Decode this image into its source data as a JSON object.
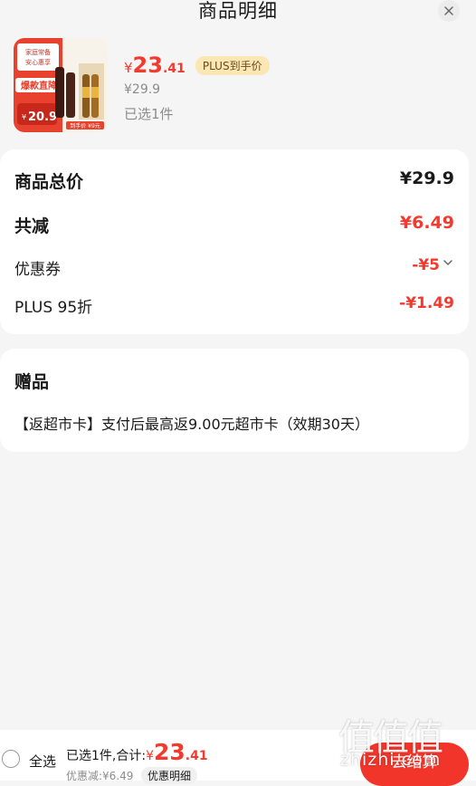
{
  "header": {
    "title": "商品明细"
  },
  "product": {
    "price_symbol": "¥",
    "price_int": "23",
    "price_dec": ".41",
    "plus_tag": "PLUS到手价",
    "original_price": "¥29.9",
    "selected_count": "已选1件",
    "thumb": {
      "badge_top": "家庭常备",
      "badge_bottom": "安心惠享",
      "banner": "爆款直降",
      "price_prefix": "¥",
      "price": "20.9",
      "coupon": "到手价 ¥9元"
    }
  },
  "summary": {
    "total_label": "商品总价",
    "total_value": "¥29.9",
    "discount_label": "共减",
    "discount_value": "¥6.49",
    "coupon_label": "优惠券",
    "coupon_value": "-¥5",
    "plus_label": "PLUS 95折",
    "plus_value": "-¥1.49"
  },
  "gift": {
    "title": "赠品",
    "text": "【返超市卡】支付后最高返9.00元超市卡（效期30天）"
  },
  "footer": {
    "select_all": "全选",
    "summary_text": "已选1件,合计:",
    "sum_symbol": "¥",
    "sum_int": "23",
    "sum_dec": ".41",
    "saved_text": "优惠减:¥6.49",
    "detail_button": "优惠明细",
    "checkout_button": "去结算"
  },
  "watermark": {
    "text": "zhizhi.com",
    "glyphs": "值值值"
  },
  "colors": {
    "accent": "#f23a2f",
    "plus_tag_bg": "#fbe7b3",
    "page_bg": "#f5f5f5"
  }
}
